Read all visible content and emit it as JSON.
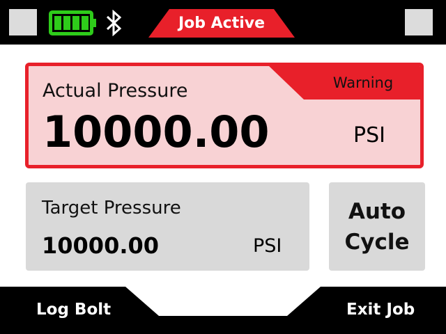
{
  "status_bar": {
    "left_button": "",
    "right_button": "",
    "battery_icon": "battery-full-icon",
    "bluetooth_icon": "bluetooth-icon",
    "job_status": "Job Active"
  },
  "actual_pressure": {
    "label": "Actual Pressure",
    "value": "10000.00",
    "unit": "PSI",
    "alert": "Warning"
  },
  "target_pressure": {
    "label": "Target Pressure",
    "value": "10000.00",
    "unit": "PSI"
  },
  "auto_cycle": {
    "line1": "Auto",
    "line2": "Cycle"
  },
  "bottom_actions": {
    "left": "Log Bolt",
    "right": "Exit Job"
  },
  "colors": {
    "alert_red": "#e8202a",
    "alert_fill": "#f8d2d4",
    "battery_green": "#2ecc1a",
    "panel_gray": "#d9d9d9"
  }
}
